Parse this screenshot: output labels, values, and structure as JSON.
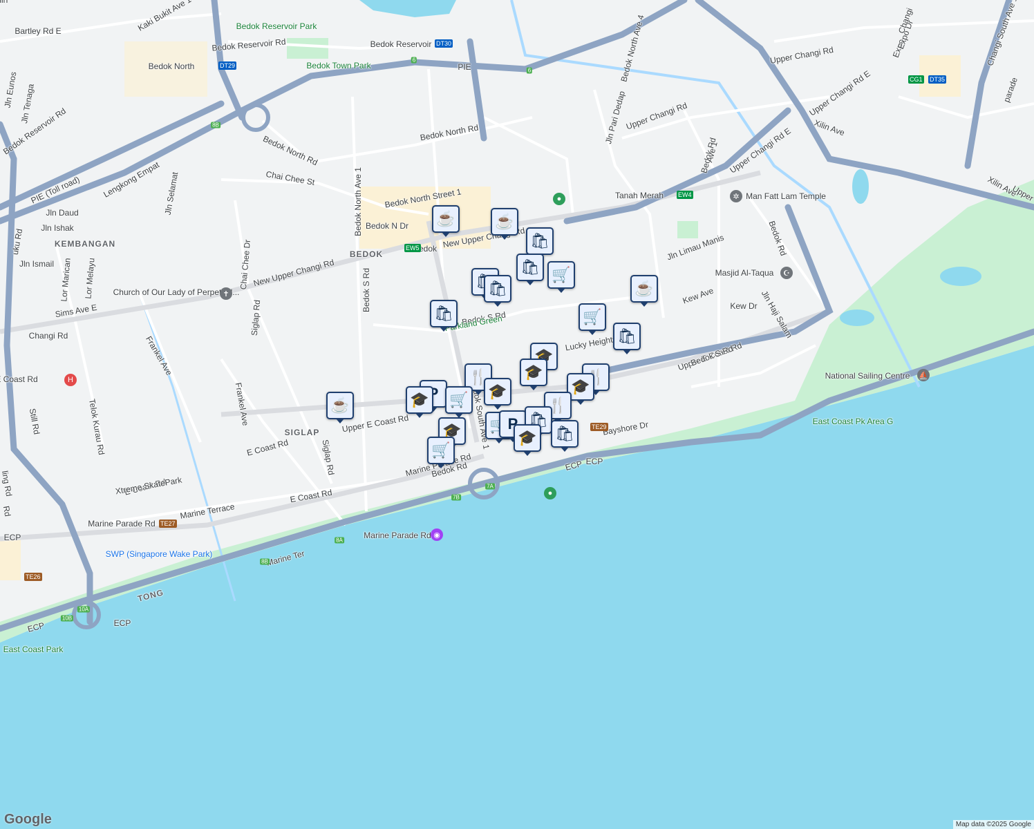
{
  "map": {
    "colors": {
      "land": "#f1f3f4",
      "sea": "#8fd9ee",
      "park": "#c9f0d3",
      "road": "#ffffff",
      "expressway": "#8ea4c3",
      "canal": "#aadaff"
    },
    "attribution": "Map data ©2025 Google",
    "logo": "Google",
    "labels": [
      {
        "text": "Bartley Rd E",
        "cls": ""
      },
      {
        "text": "Kaki Bukit Ave 1",
        "cls": ""
      },
      {
        "text": "Bedok Reservoir Park",
        "cls": "green"
      },
      {
        "text": "Bedok Reservoir Rd",
        "cls": ""
      },
      {
        "text": "Bedok Reservoir",
        "cls": ""
      },
      {
        "text": "Bedok North",
        "cls": ""
      },
      {
        "text": "Bedok Town Park",
        "cls": "green"
      },
      {
        "text": "PIE",
        "cls": ""
      },
      {
        "text": "Upper Changi Rd",
        "cls": ""
      },
      {
        "text": "Bedok North Ave 4",
        "cls": ""
      },
      {
        "text": "Expo",
        "cls": ""
      },
      {
        "text": "Expo Dr",
        "cls": ""
      },
      {
        "text": "Changi South Ave 1",
        "cls": ""
      },
      {
        "text": "Upper Changi Rd E",
        "cls": ""
      },
      {
        "text": "Xilin Ave",
        "cls": ""
      },
      {
        "text": "Bedok North Rd",
        "cls": ""
      },
      {
        "text": "Jln Pari Dedap",
        "cls": ""
      },
      {
        "text": "Upper Changi Rd",
        "cls": ""
      },
      {
        "text": "Bedok Rd",
        "cls": ""
      },
      {
        "text": "Upper Changi Rd E",
        "cls": ""
      },
      {
        "text": "Xilin Ave",
        "cls": ""
      },
      {
        "text": "Bedok Reservoir Rd",
        "cls": ""
      },
      {
        "text": "Jln Tenaga",
        "cls": ""
      },
      {
        "text": "Bedok North Rd",
        "cls": ""
      },
      {
        "text": "Chai Chee St",
        "cls": ""
      },
      {
        "text": "Bedok North Ave 1",
        "cls": ""
      },
      {
        "text": "PIE (Toll road)",
        "cls": ""
      },
      {
        "text": "Lengkong Empat",
        "cls": ""
      },
      {
        "text": "Jln Selamat",
        "cls": ""
      },
      {
        "text": "Bedok North Street 1",
        "cls": ""
      },
      {
        "text": "Tanah Merah",
        "cls": ""
      },
      {
        "text": "Man Fatt Lam Temple",
        "cls": ""
      },
      {
        "text": "Jln Daud",
        "cls": ""
      },
      {
        "text": "Jln Ishak",
        "cls": ""
      },
      {
        "text": "KEMBANGAN",
        "cls": "area"
      },
      {
        "text": "Bedok N Dr",
        "cls": ""
      },
      {
        "text": "Bedok",
        "cls": ""
      },
      {
        "text": "New Upper Changi Rd",
        "cls": ""
      },
      {
        "text": "BEDOK",
        "cls": "area"
      },
      {
        "text": "Chai Chee Dr",
        "cls": ""
      },
      {
        "text": "Bedok S Rd",
        "cls": ""
      },
      {
        "text": "Jln Limau Manis",
        "cls": ""
      },
      {
        "text": "Bedok Rd",
        "cls": ""
      },
      {
        "text": "Jln Ismail",
        "cls": ""
      },
      {
        "text": "Lor Marican",
        "cls": ""
      },
      {
        "text": "Lor Melayu",
        "cls": ""
      },
      {
        "text": "New Upper Changi Rd",
        "cls": ""
      },
      {
        "text": "Church of Our Lady of Perpetual...",
        "cls": ""
      },
      {
        "text": "Masjid Al-Taqua",
        "cls": ""
      },
      {
        "text": "Kew Ave",
        "cls": ""
      },
      {
        "text": "Kew Dr",
        "cls": ""
      },
      {
        "text": "Jln Haji Salam",
        "cls": ""
      },
      {
        "text": "Sims Ave E",
        "cls": ""
      },
      {
        "text": "Siglap Rd",
        "cls": ""
      },
      {
        "text": "Bedok S Rd",
        "cls": ""
      },
      {
        "text": "Changi Rd",
        "cls": ""
      },
      {
        "text": "Frankel Ave",
        "cls": ""
      },
      {
        "text": "Lucky Heights",
        "cls": ""
      },
      {
        "text": "Upper E Coast Rd",
        "cls": ""
      },
      {
        "text": "National Sailing Centre",
        "cls": ""
      },
      {
        "text": "Telok Kurau Rd",
        "cls": ""
      },
      {
        "text": "Frankel Ave",
        "cls": ""
      },
      {
        "text": "East Coast Pk Area G",
        "cls": "green"
      },
      {
        "text": "Still Rd",
        "cls": ""
      },
      {
        "text": "Upper E Coast Rd",
        "cls": ""
      },
      {
        "text": "SIGLAP",
        "cls": "area"
      },
      {
        "text": "E Coast Rd",
        "cls": ""
      },
      {
        "text": "Siglap Rd",
        "cls": ""
      },
      {
        "text": "Bedok South Ave 1",
        "cls": ""
      },
      {
        "text": "E Coast Rd",
        "cls": ""
      },
      {
        "text": "Bayshore Dr",
        "cls": ""
      },
      {
        "text": "ECP",
        "cls": ""
      },
      {
        "text": "Marine Parade Rd",
        "cls": ""
      },
      {
        "text": "ECP",
        "cls": ""
      },
      {
        "text": "Xtreme SkatePark",
        "cls": ""
      },
      {
        "text": "E Coast Rd",
        "cls": ""
      },
      {
        "text": "Marine Parade Rd",
        "cls": ""
      },
      {
        "text": "Marine Terrace",
        "cls": ""
      },
      {
        "text": "Marine Parade Rd",
        "cls": ""
      },
      {
        "text": "SWP (Singapore Wake Park)",
        "cls": "sea"
      },
      {
        "text": "Marine Ter",
        "cls": ""
      },
      {
        "text": "ECP",
        "cls": ""
      },
      {
        "text": "TONG",
        "cls": "area"
      },
      {
        "text": "ECP",
        "cls": ""
      },
      {
        "text": "ECP",
        "cls": ""
      },
      {
        "text": "East Coast Park",
        "cls": "green"
      },
      {
        "text": "Parkland Green",
        "cls": "green"
      },
      {
        "text": "Bedok S Rd",
        "cls": ""
      },
      {
        "text": "Upper E Coast Rd",
        "cls": ""
      },
      {
        "text": "Rd",
        "cls": ""
      },
      {
        "text": "ling Rd",
        "cls": ""
      },
      {
        "text": "uku Rd",
        "cls": ""
      },
      {
        "text": "Jln Eunos",
        "cls": ""
      },
      {
        "text": "Ave 1",
        "cls": ""
      },
      {
        "text": "Bedok Rd",
        "cls": ""
      },
      {
        "text": "parade",
        "cls": ""
      },
      {
        "text": "Changi",
        "cls": ""
      },
      {
        "text": "Upper",
        "cls": ""
      },
      {
        "text": "Xilin",
        "cls": ""
      }
    ],
    "stations": [
      {
        "name": "Bedok Reservoir",
        "code": "DT30",
        "line": "dt"
      },
      {
        "name": "Bedok North",
        "code": "DT29",
        "line": "dt"
      },
      {
        "name": "Tanah Merah",
        "code": "EW4",
        "line": "ew"
      },
      {
        "name": "Bedok",
        "code": "EW5",
        "line": "ew"
      },
      {
        "name": "Expo",
        "code": "CG1",
        "line": "cg"
      },
      {
        "name": "Expo",
        "code": "DT35",
        "line": "dt"
      },
      {
        "name": "Marine Terrace",
        "code": "TE27",
        "line": "te"
      },
      {
        "name": "Bayshore",
        "code": "TE29",
        "line": "te"
      },
      {
        "name": "Parade",
        "code": "TE26",
        "line": "te"
      }
    ],
    "exits": [
      "6",
      "6",
      "8B",
      "8A",
      "8B",
      "7A",
      "7B",
      "10A",
      "10B"
    ],
    "markers": [
      {
        "type": "cafe",
        "icon": "cafe-icon"
      },
      {
        "type": "cafe",
        "icon": "cafe-icon"
      },
      {
        "type": "shopping",
        "icon": "shopping-bag-icon"
      },
      {
        "type": "shopping",
        "icon": "shopping-bag-icon"
      },
      {
        "type": "grocery",
        "icon": "shopping-cart-icon"
      },
      {
        "type": "shopping",
        "icon": "shopping-bag-icon"
      },
      {
        "type": "shopping",
        "icon": "shopping-bag-icon"
      },
      {
        "type": "cafe",
        "icon": "cafe-icon"
      },
      {
        "type": "grocery",
        "icon": "shopping-cart-icon"
      },
      {
        "type": "shopping",
        "icon": "shopping-bag-icon"
      },
      {
        "type": "shopping",
        "icon": "shopping-bag-icon"
      },
      {
        "type": "school",
        "icon": "school-icon"
      },
      {
        "type": "school",
        "icon": "school-icon"
      },
      {
        "type": "restaurant",
        "icon": "restaurant-icon"
      },
      {
        "type": "restaurant",
        "icon": "restaurant-icon"
      },
      {
        "type": "school",
        "icon": "school-icon"
      },
      {
        "type": "school",
        "icon": "school-icon"
      },
      {
        "type": "restaurant",
        "icon": "restaurant-icon"
      },
      {
        "type": "parking",
        "icon": "parking-icon"
      },
      {
        "type": "school",
        "icon": "school-icon"
      },
      {
        "type": "grocery",
        "icon": "shopping-cart-icon"
      },
      {
        "type": "cafe",
        "icon": "cafe-icon"
      },
      {
        "type": "school",
        "icon": "school-icon"
      },
      {
        "type": "grocery",
        "icon": "shopping-cart-icon"
      },
      {
        "type": "parking",
        "icon": "parking-icon"
      },
      {
        "type": "shopping",
        "icon": "shopping-bag-icon"
      },
      {
        "type": "school",
        "icon": "school-icon"
      },
      {
        "type": "shopping",
        "icon": "shopping-bag-icon"
      },
      {
        "type": "grocery",
        "icon": "shopping-cart-icon"
      }
    ],
    "pois": [
      {
        "name": "Church of Our Lady of Perpetual...",
        "icon": "cross-icon",
        "color": "gray"
      },
      {
        "name": "Masjid Al-Taqua",
        "icon": "mosque-icon",
        "color": "gray"
      },
      {
        "name": "Man Fatt Lam Temple",
        "icon": "temple-icon",
        "color": "gray"
      },
      {
        "name": "National Sailing Centre",
        "icon": "sailing-icon",
        "color": "gray"
      },
      {
        "name": "Xtreme SkatePark",
        "icon": "park-icon",
        "color": "green"
      },
      {
        "name": "SWP (Singapore Wake Park)",
        "icon": "wake-park-icon",
        "color": "purple"
      },
      {
        "name": "Hospital",
        "icon": "hospital-icon",
        "color": "red"
      },
      {
        "name": "Park",
        "icon": "park-icon",
        "color": "green"
      }
    ]
  }
}
